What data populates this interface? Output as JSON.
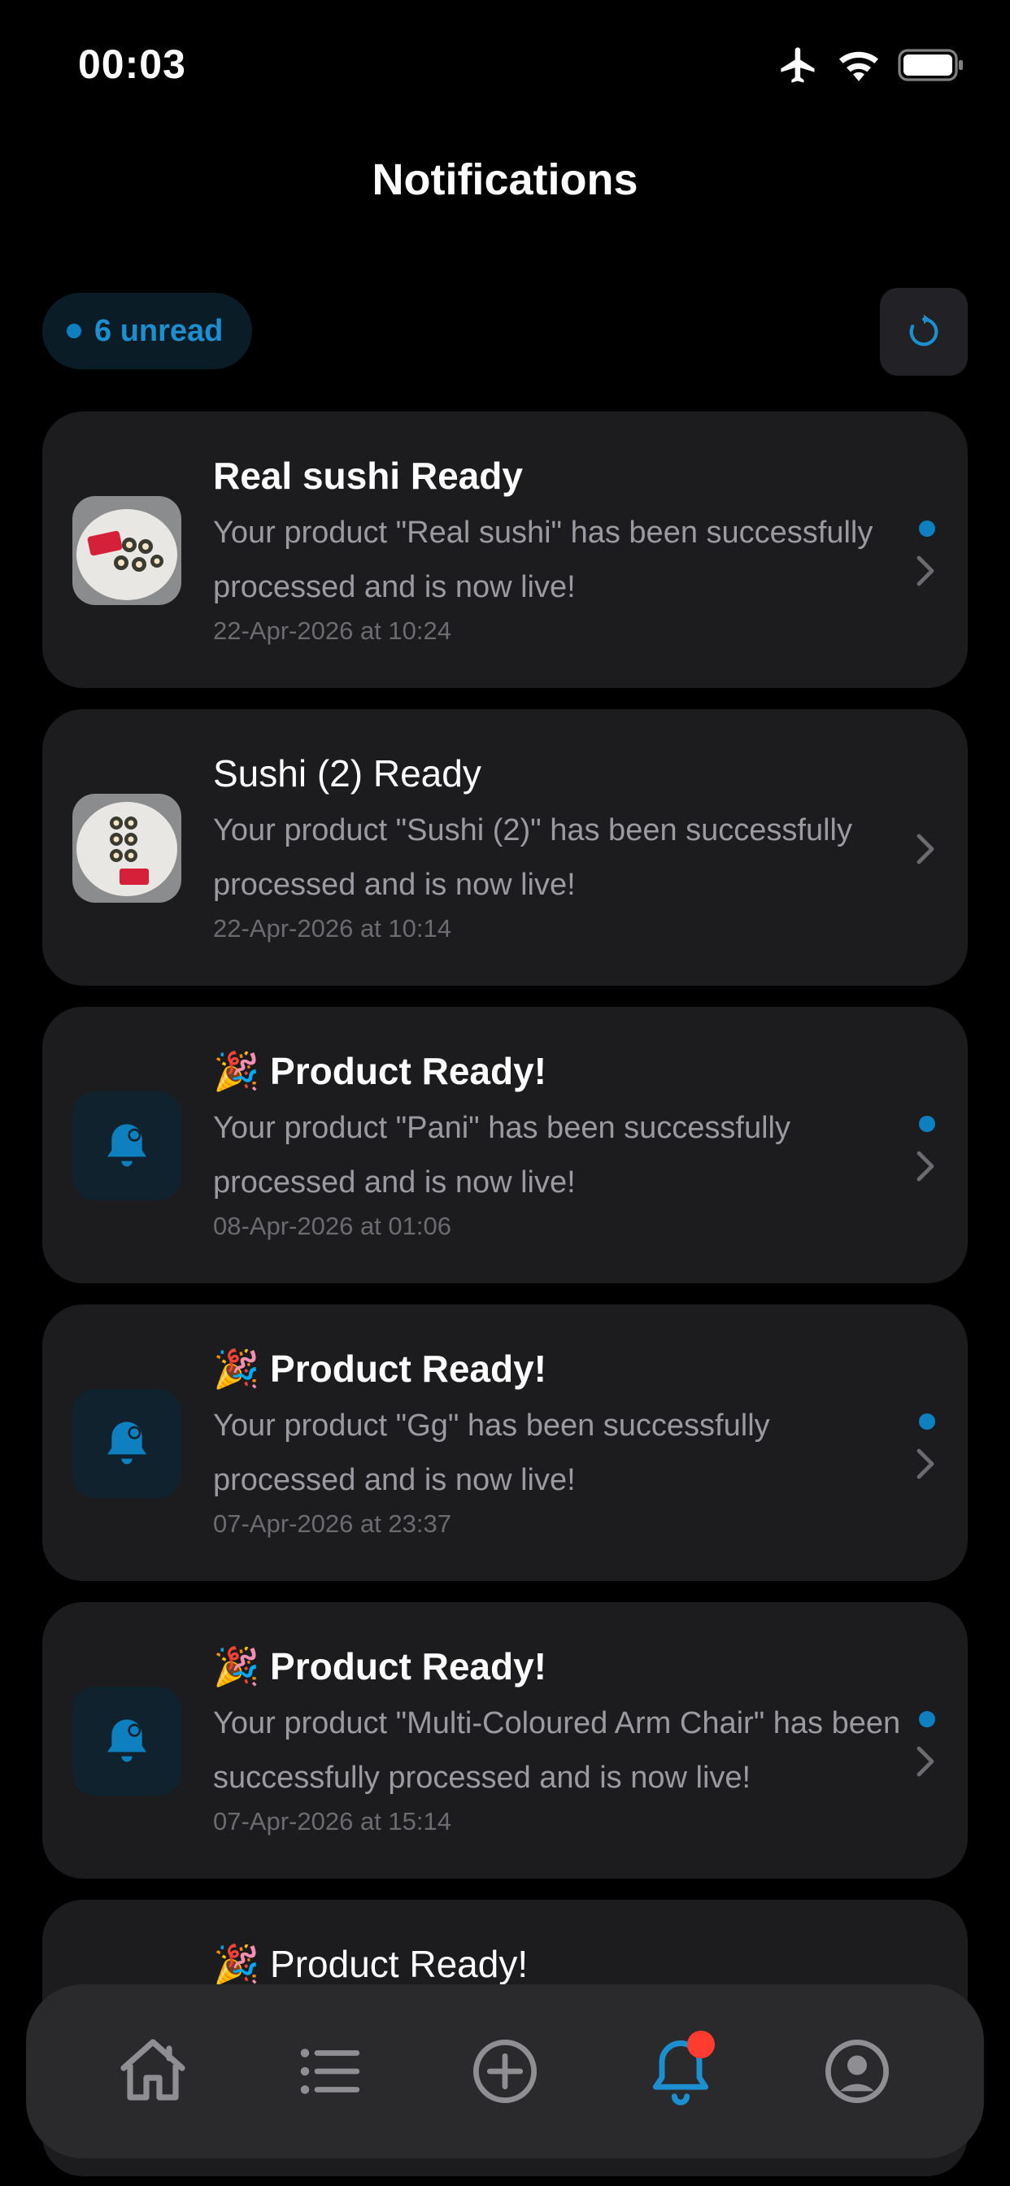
{
  "status_bar": {
    "time": "00:03"
  },
  "header": {
    "title": "Notifications"
  },
  "toolbar": {
    "unread_label": "6 unread"
  },
  "notifications": [
    {
      "title": "Real sushi Ready",
      "body": "Your product \"Real sushi\" has been successfully processed and is now live!",
      "date": "22-Apr-2026 at 10:24",
      "unread": true,
      "icon": "product-photo"
    },
    {
      "title": "Sushi (2) Ready",
      "body": "Your product \"Sushi (2)\" has been successfully processed and is now live!",
      "date": "22-Apr-2026 at 10:14",
      "unread": false,
      "icon": "product-photo"
    },
    {
      "title": "🎉 Product Ready!",
      "body": "Your product \"Pani\" has been successfully processed and is now live!",
      "date": "08-Apr-2026 at 01:06",
      "unread": true,
      "icon": "bell-icon"
    },
    {
      "title": "🎉 Product Ready!",
      "body": "Your product \"Gg\" has been successfully processed and is now live!",
      "date": "07-Apr-2026 at 23:37",
      "unread": true,
      "icon": "bell-icon"
    },
    {
      "title": "🎉 Product Ready!",
      "body": "Your product \"Multi-Coloured Arm Chair\" has been successfully processed and is now live!",
      "date": "07-Apr-2026 at 15:14",
      "unread": true,
      "icon": "bell-icon"
    },
    {
      "title": "🎉 Product Ready!",
      "icon": "bell-icon"
    }
  ],
  "tab_bar": {
    "tabs": [
      {
        "icon": "home-icon",
        "active": false
      },
      {
        "icon": "list-icon",
        "active": false
      },
      {
        "icon": "add-circle-icon",
        "active": false
      },
      {
        "icon": "bell-icon",
        "active": true,
        "badge": true
      },
      {
        "icon": "profile-icon",
        "active": false
      }
    ]
  },
  "colors": {
    "accent": "#1c8fd0",
    "unread_dot": "#0e7fbf",
    "card_bg": "#1c1c1e",
    "badge": "#ff3b30"
  }
}
